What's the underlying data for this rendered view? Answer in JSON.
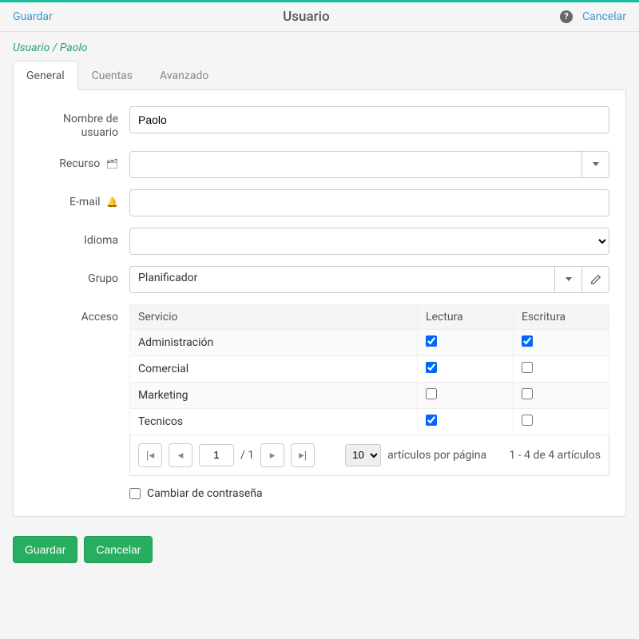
{
  "header": {
    "save": "Guardar",
    "title": "Usuario",
    "cancel": "Cancelar"
  },
  "breadcrumb": "Usuario / Paolo",
  "tabs": {
    "general": "General",
    "cuentas": "Cuentas",
    "avanzado": "Avanzado"
  },
  "form": {
    "username_label": "Nombre de usuario",
    "username_value": "Paolo",
    "recurso_label": "Recurso",
    "recurso_value": "",
    "email_label": "E-mail",
    "email_value": "",
    "idioma_label": "Idioma",
    "idioma_value": "",
    "grupo_label": "Grupo",
    "grupo_value": "Planificador",
    "acceso_label": "Acceso",
    "change_pw_label": "Cambiar de contraseña"
  },
  "access_table": {
    "col_servicio": "Servicio",
    "col_lectura": "Lectura",
    "col_escritura": "Escritura",
    "rows": [
      {
        "service": "Administración",
        "read": true,
        "write": true
      },
      {
        "service": "Comercial",
        "read": true,
        "write": false
      },
      {
        "service": "Marketing",
        "read": false,
        "write": false
      },
      {
        "service": "Tecnicos",
        "read": true,
        "write": false
      }
    ]
  },
  "pager": {
    "page": "1",
    "total_pages": "/ 1",
    "page_size": "10",
    "per_page_label": "artículos por página",
    "range_label": "1 - 4 de 4 artículos"
  },
  "footer": {
    "save": "Guardar",
    "cancel": "Cancelar"
  }
}
